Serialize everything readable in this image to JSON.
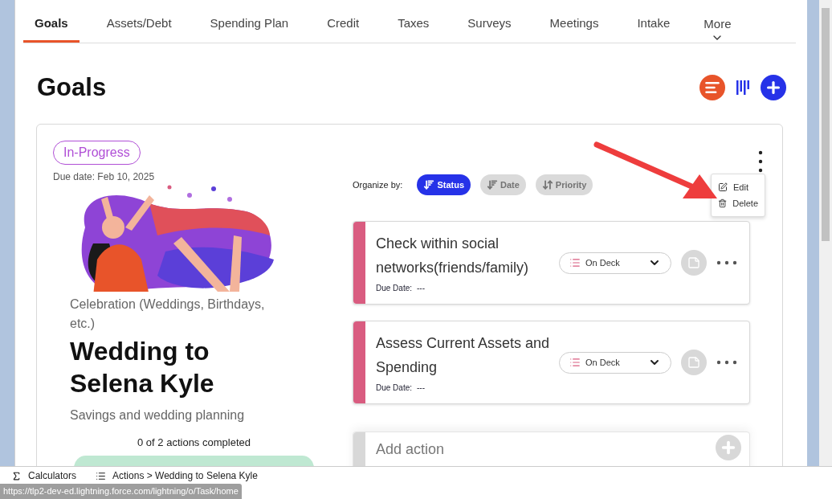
{
  "tabs": [
    {
      "label": "Goals",
      "selected": true
    },
    {
      "label": "Assets/Debt",
      "selected": false
    },
    {
      "label": "Spending Plan",
      "selected": false
    },
    {
      "label": "Credit",
      "selected": false
    },
    {
      "label": "Taxes",
      "selected": false
    },
    {
      "label": "Surveys",
      "selected": false
    },
    {
      "label": "Meetings",
      "selected": false
    },
    {
      "label": "Intake",
      "selected": false
    }
  ],
  "more_tab": {
    "label": "More"
  },
  "page_title": "Goals",
  "goal": {
    "status": "In-Progress",
    "due_date": "Due date: Feb 10, 2025",
    "category": "Celebration (Weddings, Birthdays, etc.)",
    "title": "Wedding to Selena Kyle",
    "description": "Savings and wedding planning",
    "progress_text": "0 of 2 actions completed"
  },
  "organize": {
    "label": "Organize by:",
    "options": [
      {
        "label": "Status",
        "selected": true
      },
      {
        "label": "Date",
        "selected": false
      },
      {
        "label": "Priority",
        "selected": false
      }
    ]
  },
  "menu": {
    "items": [
      {
        "label": "Edit",
        "kind": "edit"
      },
      {
        "label": "Delete",
        "kind": "delete"
      }
    ]
  },
  "actions": [
    {
      "title": "Check within social networks(friends/family)",
      "due_label": "Due Date:",
      "due_value": "---",
      "status": "On Deck",
      "color": "#d95c80"
    },
    {
      "title": "Assess Current Assets and Spending",
      "due_label": "Due Date:",
      "due_value": "---",
      "status": "On Deck",
      "color": "#d95c80"
    }
  ],
  "add_action": {
    "label": "Add action"
  },
  "footer": {
    "items": [
      {
        "label": "Calculators",
        "kind": "sigma"
      },
      {
        "label": "Actions > Wedding to Selena Kyle",
        "kind": "list"
      }
    ]
  },
  "url_tooltip": "https://tlp2-dev-ed.lightning.force.com/lightning/o/Task/home"
}
